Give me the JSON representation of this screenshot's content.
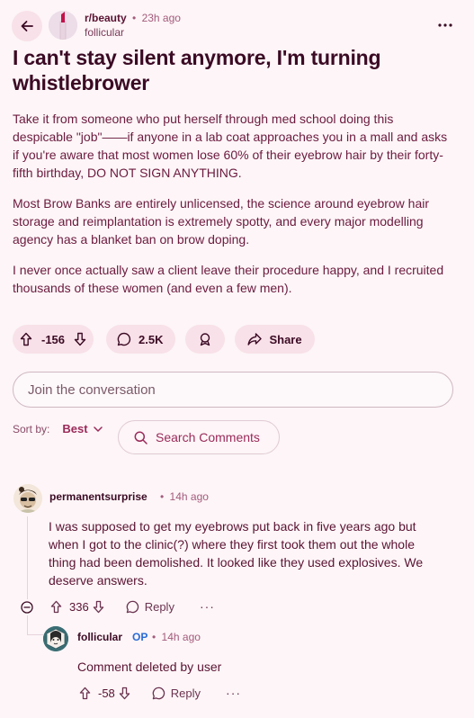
{
  "header": {
    "subreddit": "r/beauty",
    "time": "23h ago",
    "separator": "•",
    "author": "follicular"
  },
  "post": {
    "title": "I can't stay silent anymore, I'm turning whistlebrower",
    "paragraphs": [
      "Take it from someone who put herself through med school doing this despicable \"job\"——if anyone in a lab coat approaches you in a mall and asks if you're aware that most women lose 60% of their eyebrow hair by their forty-fifth birthday, DO NOT SIGN ANYTHING.",
      "Most Brow Banks are entirely unlicensed, the science around eyebrow hair storage and reimplantation is extremely spotty, and every major modelling agency has a blanket ban on brow doping.",
      "I never once actually saw a client leave their procedure happy, and I recruited thousands of these women (and even a few men)."
    ]
  },
  "actions": {
    "score": "-156",
    "comments": "2.5K",
    "share": "Share"
  },
  "join": {
    "placeholder": "Join the conversation"
  },
  "sort": {
    "label": "Sort by:",
    "value": "Best"
  },
  "search_comments": {
    "label": "Search Comments"
  },
  "comments": [
    {
      "user": "permanentsurprise",
      "time": "14h ago",
      "body": "I was supposed to get my eyebrows put back in five years ago but when I got to the clinic(?) where they first took them out the whole thing had been demolished. It looked like they used explosives. We deserve answers.",
      "score": "336",
      "reply": "Reply",
      "more": "···"
    },
    {
      "user": "follicular",
      "op": "OP",
      "time": "14h ago",
      "body": "Comment deleted by user",
      "score": "-58",
      "reply": "Reply",
      "more": "···"
    }
  ],
  "colors": {
    "background": "#fdf5f7",
    "pill": "#f8e1e8",
    "text": "#3b0a24",
    "accent": "#9a2a5a",
    "op": "#2a6ad6"
  },
  "icons": [
    "back-arrow-icon",
    "more-horizontal-icon",
    "upvote-icon",
    "downvote-icon",
    "comment-icon",
    "award-icon",
    "share-icon",
    "chevron-down-icon",
    "search-icon",
    "collapse-icon"
  ]
}
